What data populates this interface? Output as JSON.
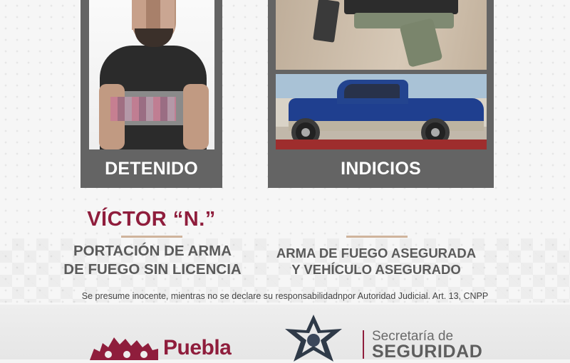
{
  "cards": {
    "detained_label": "DETENIDO",
    "evidence_label": "INDICIOS"
  },
  "person": {
    "name": "VÍCTOR “N.”"
  },
  "charge": {
    "line1": "PORTACIÓN DE ARMA",
    "line2": "DE FUEGO SIN LICENCIA"
  },
  "evidence": {
    "line1": "ARMA DE FUEGO ASEGURADA",
    "line2": "Y VEHÍCULO ASEGURADO"
  },
  "disclaimer": "Se presume inocente, mientras no se declare su responsabilidadnpor Autoridad Judicial. Art. 13, CNPP",
  "footer": {
    "puebla_logo_text": "Puebla",
    "secretaria_line1": "Secretaría de",
    "secretaria_line2": "SEGURIDAD"
  },
  "colors": {
    "brand": "#8f1d3c",
    "card": "#646464",
    "rule": "#cfb49c",
    "text_gray": "#5a5a5a"
  },
  "icons": {
    "puebla_mark": "puebla-emblem-icon",
    "police_badge": "police-star-badge-icon"
  }
}
